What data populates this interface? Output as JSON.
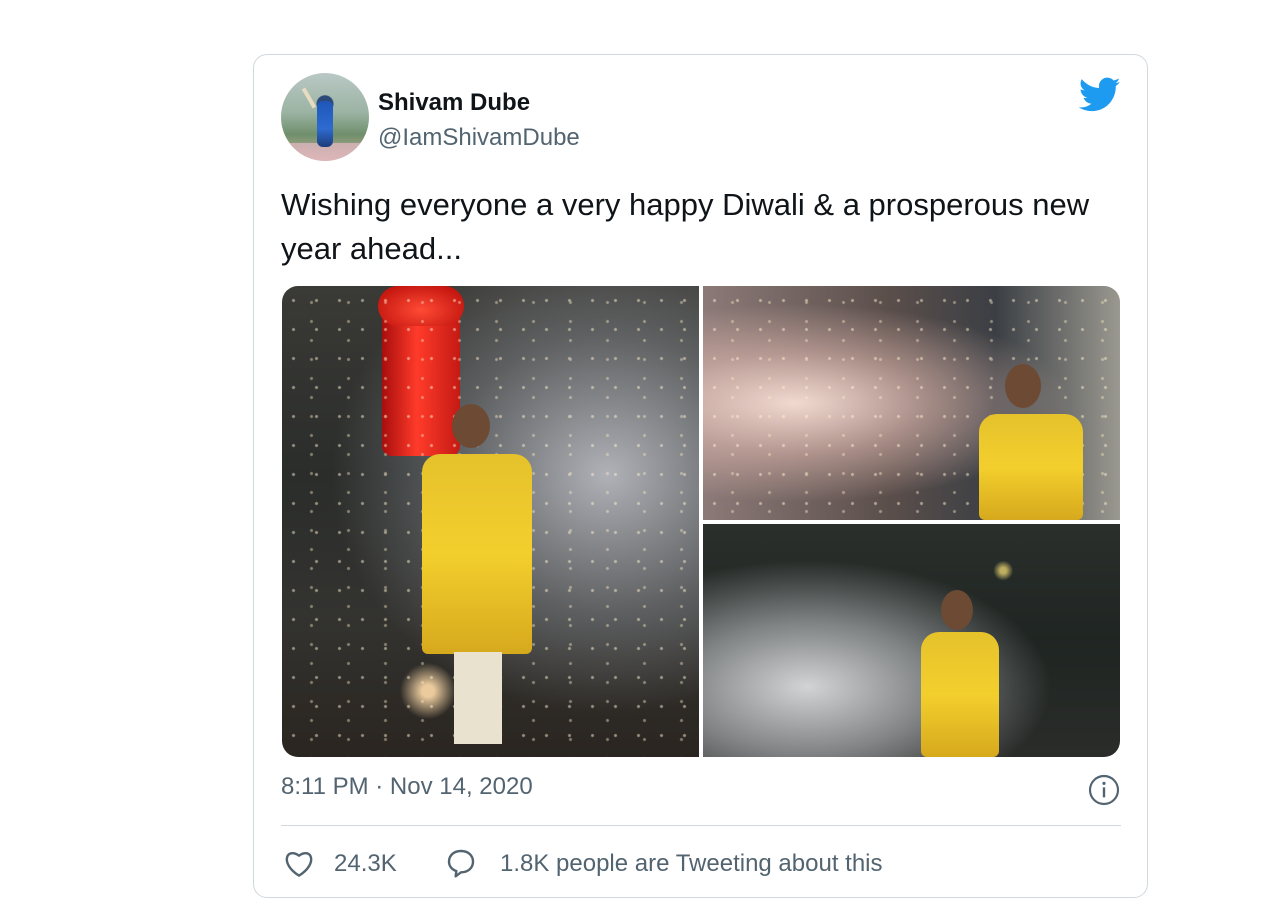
{
  "author": {
    "name": "Shivam Dube",
    "handle": "@IamShivamDube"
  },
  "tweet": {
    "text": "Wishing everyone a very happy Diwali & a prosperous new year ahead...",
    "timestamp": "8:11 PM · Nov 14, 2020"
  },
  "stats": {
    "likes": "24.3K",
    "tweeting_label": "1.8K people are Tweeting about this"
  },
  "media": {
    "photo_count": 3
  },
  "colors": {
    "twitter_blue": "#1d9bf0",
    "secondary_text": "#536471",
    "border": "#cfd9de"
  },
  "icons": [
    "twitter-bird-icon",
    "info-icon",
    "heart-icon",
    "speech-bubble-icon"
  ]
}
